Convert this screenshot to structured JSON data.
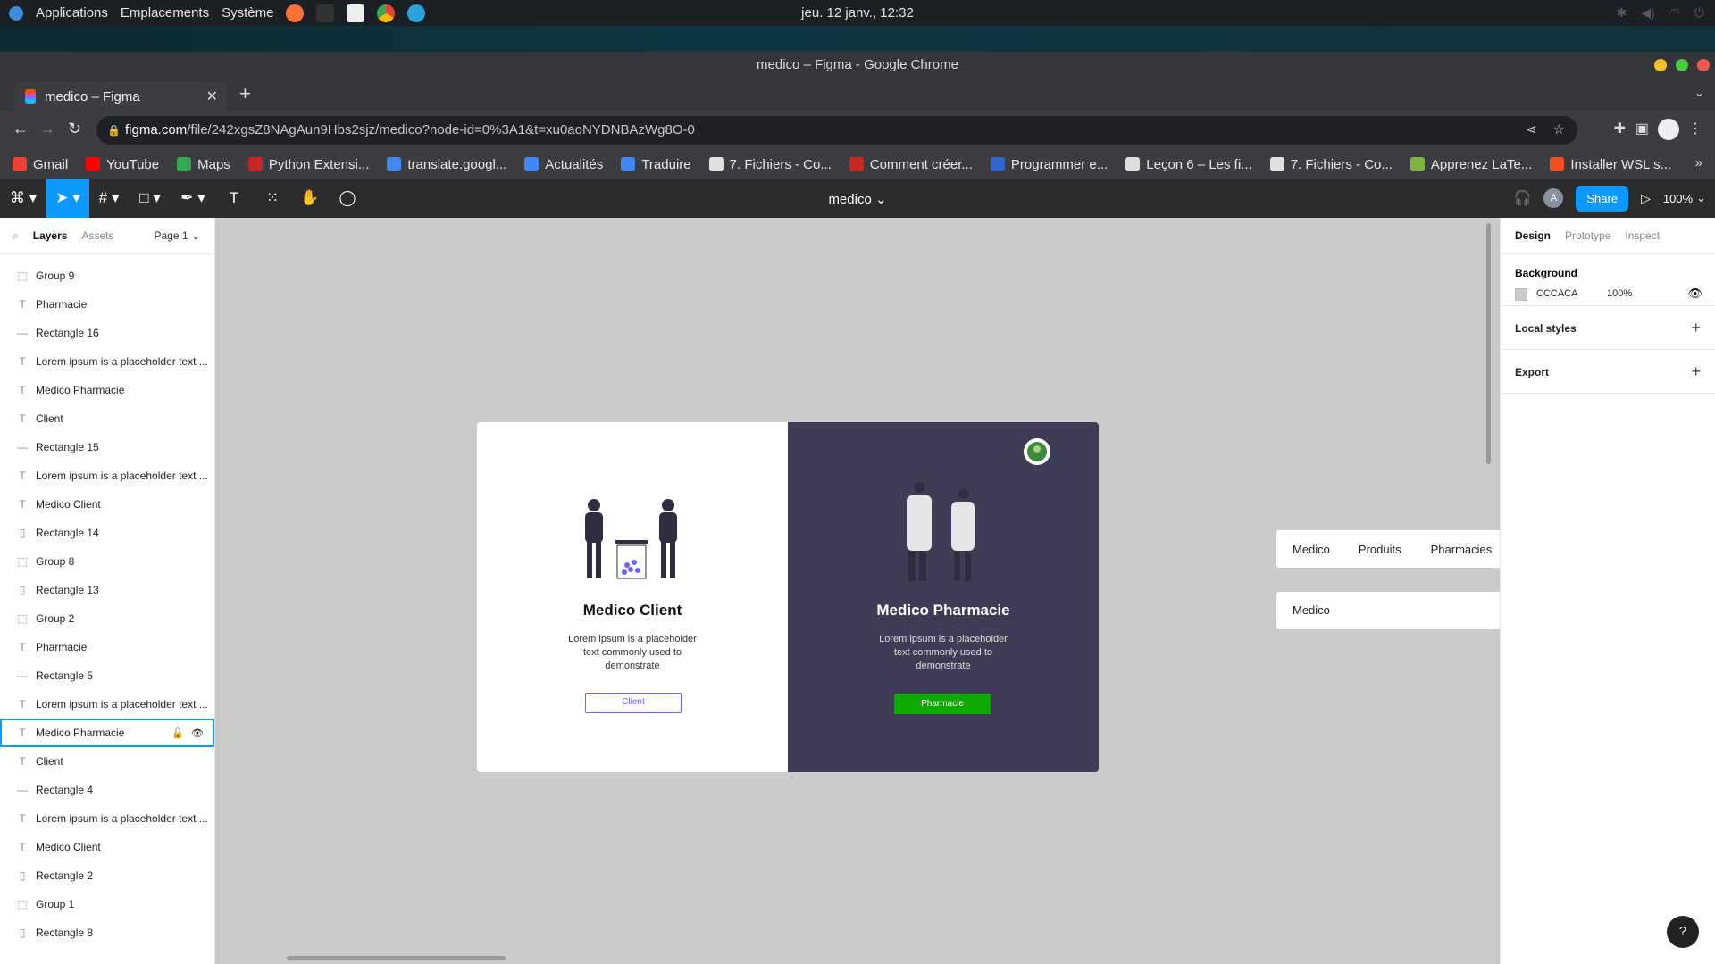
{
  "os": {
    "menu": [
      "Applications",
      "Emplacements",
      "Système"
    ],
    "clock": "jeu. 12 janv., 12:32"
  },
  "window": {
    "title": "medico – Figma - Google Chrome"
  },
  "tab": {
    "title": "medico – Figma"
  },
  "address": {
    "host": "figma.com",
    "path": "/file/242xgsZ8NAgAun9Hbs2sjz/medico?node-id=0%3A1&t=xu0aoNYDNBAzWg8O-0"
  },
  "bookmarks": [
    {
      "label": "Gmail",
      "color": "#ea4335"
    },
    {
      "label": "YouTube",
      "color": "#ff0000"
    },
    {
      "label": "Maps",
      "color": "#34a853"
    },
    {
      "label": "Python Extensi...",
      "color": "#c62828"
    },
    {
      "label": "translate.googl...",
      "color": "#4285f4"
    },
    {
      "label": "Actualités",
      "color": "#4285f4"
    },
    {
      "label": "Traduire",
      "color": "#4285f4"
    },
    {
      "label": "7. Fichiers - Co...",
      "color": "#e0e0e0"
    },
    {
      "label": "Comment créer...",
      "color": "#c62828"
    },
    {
      "label": "Programmer e...",
      "color": "#3366cc"
    },
    {
      "label": "Leçon 6 – Les fi...",
      "color": "#dddddd"
    },
    {
      "label": "7. Fichiers - Co...",
      "color": "#e0e0e0"
    },
    {
      "label": "Apprenez LaTe...",
      "color": "#7cb342"
    },
    {
      "label": "Installer WSL s...",
      "color": "#f25022"
    }
  ],
  "figma": {
    "file_name": "medico",
    "share": "Share",
    "zoom": "100%",
    "user_initial": "A",
    "left_tabs": {
      "layers": "Layers",
      "assets": "Assets",
      "page": "Page 1"
    },
    "layers": [
      {
        "name": "Group 9",
        "icon": "group-icon"
      },
      {
        "name": "Pharmacie",
        "icon": "text-icon"
      },
      {
        "name": "Rectangle 16",
        "icon": "line-icon"
      },
      {
        "name": "Lorem ipsum is a placeholder text ...",
        "icon": "text-icon"
      },
      {
        "name": "Medico Pharmacie",
        "icon": "text-icon"
      },
      {
        "name": "Client",
        "icon": "text-icon"
      },
      {
        "name": "Rectangle 15",
        "icon": "line-icon"
      },
      {
        "name": "Lorem ipsum is a placeholder text ...",
        "icon": "text-icon"
      },
      {
        "name": "Medico Client",
        "icon": "text-icon"
      },
      {
        "name": "Rectangle 14",
        "icon": "rect-icon"
      },
      {
        "name": "Group 8",
        "icon": "group-icon"
      },
      {
        "name": "Rectangle 13",
        "icon": "rect-icon"
      },
      {
        "name": "Group 2",
        "icon": "group-icon"
      },
      {
        "name": "Pharmacie",
        "icon": "text-icon"
      },
      {
        "name": "Rectangle 5",
        "icon": "line-icon"
      },
      {
        "name": "Lorem ipsum is a placeholder text ...",
        "icon": "text-icon"
      },
      {
        "name": "Medico Pharmacie",
        "icon": "text-icon",
        "selected": true
      },
      {
        "name": "Client",
        "icon": "text-icon"
      },
      {
        "name": "Rectangle 4",
        "icon": "line-icon"
      },
      {
        "name": "Lorem ipsum is a placeholder text ...",
        "icon": "text-icon"
      },
      {
        "name": "Medico Client",
        "icon": "text-icon"
      },
      {
        "name": "Rectangle 2",
        "icon": "rect-icon"
      },
      {
        "name": "Group 1",
        "icon": "group-icon"
      },
      {
        "name": "Rectangle 8",
        "icon": "rect-icon"
      }
    ],
    "right_tabs": {
      "design": "Design",
      "prototype": "Prototype",
      "inspect": "Inspect"
    },
    "background": {
      "label": "Background",
      "hex": "CCCACA",
      "opacity": "100%"
    },
    "local_styles": "Local styles",
    "export": "Export",
    "canvas": {
      "client_title": "Medico Client",
      "client_desc": "Lorem ipsum is a placeholder text commonly used to demonstrate",
      "client_button": "Client",
      "pharma_title": "Medico Pharmacie",
      "pharma_desc": "Lorem ipsum is a placeholder text commonly used to demonstrate",
      "pharma_button": "Pharmacie",
      "nav_items": [
        "Medico",
        "Produits",
        "Pharmacies"
      ],
      "nav2_item": "Medico"
    }
  }
}
